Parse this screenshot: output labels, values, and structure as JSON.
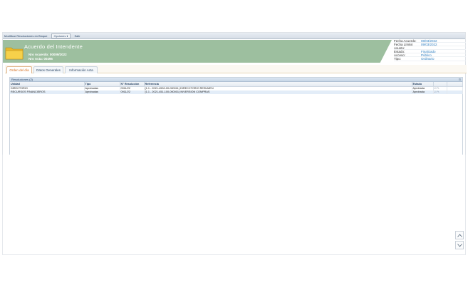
{
  "menubar": {
    "items": [
      "Modificar Resoluciones en Bloque",
      "Opciones ▾",
      "Salir"
    ]
  },
  "banner": {
    "title": "Acuerdo del Intendente",
    "numero_acuerdo": "Nro Acuerdo: 00009/2022",
    "numero_acta": "Nro Acta: 00495"
  },
  "meta": [
    {
      "k": "Fecha Acuerdo:",
      "v": "08/03/2022"
    },
    {
      "k": "Fecha Límite:",
      "v": "09/03/2022"
    },
    {
      "k": "Asunto:",
      "v": ""
    },
    {
      "k": "Estado:",
      "v": "Finalizado"
    },
    {
      "k": "Acceso:",
      "v": "Público"
    },
    {
      "k": "Tipo:",
      "v": "Ordinario"
    }
  ],
  "tabs": [
    "Orden del día",
    "Datos Generales",
    "Información Acta"
  ],
  "panel": {
    "title": "Resoluciones (2)"
  },
  "table": {
    "headers": [
      "Unidad",
      "Tipo",
      "N° Resolución",
      "Referencia",
      "Estado",
      ""
    ],
    "rows": [
      [
        "DIRECTORIO",
        "Aprobadas",
        "0911/22",
        "(1.1 - 2021-4532-00-000011) DIRECCTORIO RESUMEN",
        "Aprobada",
        "☑ ✎"
      ],
      [
        "RECURSOS FINANCIEROS",
        "Aprobadas",
        "0911/22",
        "(1.1 - 2021-451-100-000001) INVERSIÓN COMPRAS",
        "Aprobada",
        "☑ ✎"
      ]
    ]
  },
  "colors": {
    "banner": "#9dbf9f",
    "active_tab": "#d46b1b",
    "link": "#2f7fc1"
  }
}
